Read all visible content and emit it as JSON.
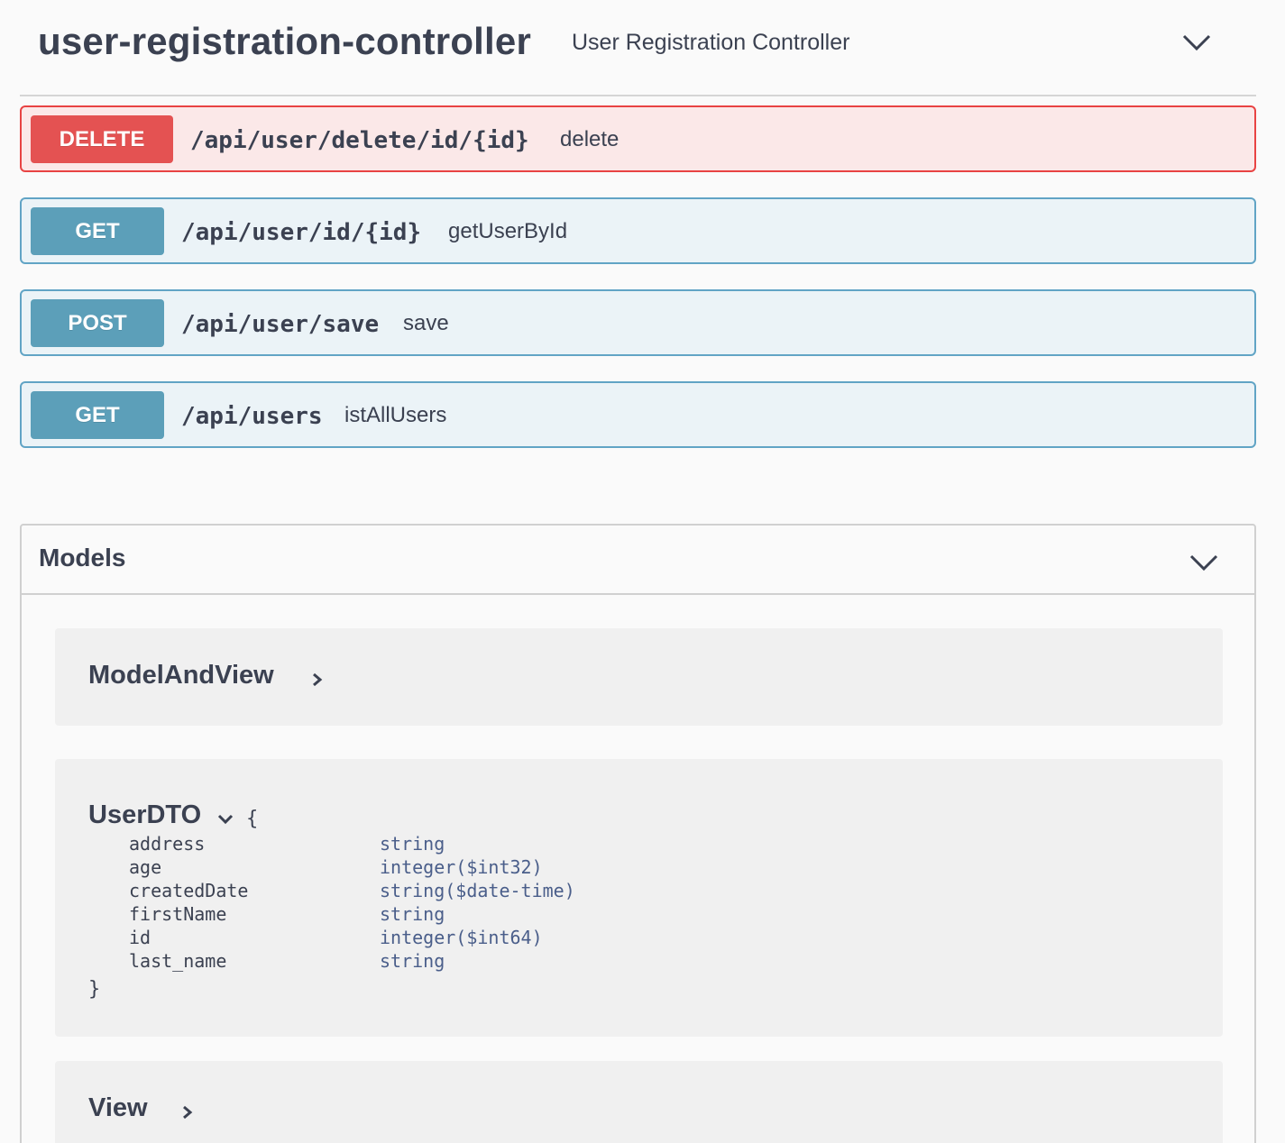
{
  "tag": {
    "name": "user-registration-controller",
    "description": "User Registration Controller",
    "expand_icon": "chevron-down-icon"
  },
  "operations": [
    {
      "method": "DELETE",
      "path": "/api/user/delete/id/{id}",
      "summary": "delete",
      "color": "#e45252"
    },
    {
      "method": "GET",
      "path": "/api/user/id/{id}",
      "summary": "getUserById",
      "color": "#5c9fb9"
    },
    {
      "method": "POST",
      "path": "/api/user/save",
      "summary": "save",
      "color": "#5c9fb9"
    },
    {
      "method": "GET",
      "path": "/api/users",
      "summary": "istAllUsers",
      "color": "#5c9fb9"
    }
  ],
  "models": {
    "title": "Models",
    "expand_icon": "chevron-down-icon",
    "items": [
      {
        "name": "ModelAndView",
        "state": "collapsed",
        "icon": "chevron-right-icon"
      },
      {
        "name": "UserDTO",
        "state": "expanded",
        "icon": "chevron-down-icon",
        "open_brace": "{",
        "close_brace": "}",
        "properties": [
          {
            "name": "address",
            "type": "string"
          },
          {
            "name": "age",
            "type": "integer($int32)"
          },
          {
            "name": "createdDate",
            "type": "string($date-time)"
          },
          {
            "name": "firstName",
            "type": "string"
          },
          {
            "name": "id",
            "type": "integer($int64)"
          },
          {
            "name": "last_name",
            "type": "string"
          }
        ]
      },
      {
        "name": "View",
        "state": "collapsed",
        "icon": "chevron-right-icon"
      }
    ]
  }
}
